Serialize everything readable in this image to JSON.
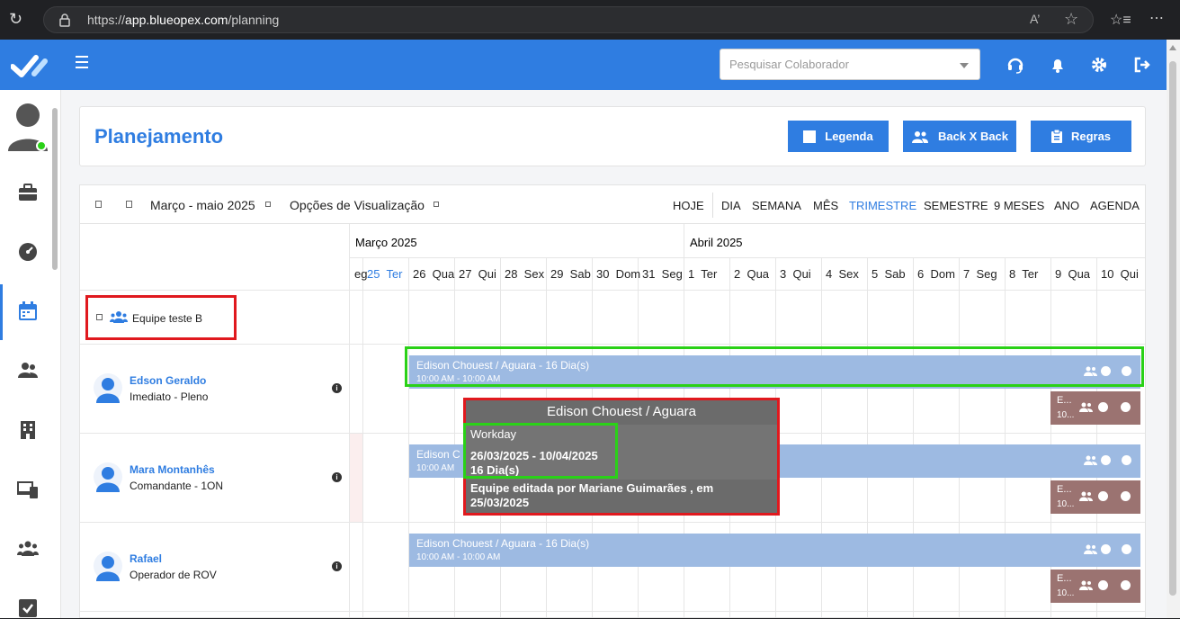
{
  "browser": {
    "url_prefix": "https://",
    "url_host": "app.blueopex.com",
    "url_path": "/planning"
  },
  "header": {
    "search_placeholder": "Pesquisar Colaborador"
  },
  "page": {
    "title": "Planejamento",
    "buttons": {
      "legend": "Legenda",
      "backxback": "Back X Back",
      "rules": "Regras"
    }
  },
  "toolbar": {
    "range": "Março - maio 2025",
    "view_options": "Opções de Visualização",
    "views": [
      "HOJE",
      "DIA",
      "SEMANA",
      "MÊS",
      "TRIMESTRE",
      "SEMESTRE",
      "9 MESES",
      "ANO",
      "AGENDA"
    ],
    "active_view": "TRIMESTRE"
  },
  "calendar": {
    "months": [
      "Março 2025",
      "Abril 2025"
    ],
    "days": [
      "eg",
      "25  Ter",
      "26  Qua",
      "27  Qui",
      "28  Sex",
      "29  Sab",
      "30  Dom",
      "31  Seg",
      "1  Ter",
      "2  Qua",
      "3  Qui",
      "4  Sex",
      "5  Sab",
      "6  Dom",
      "7  Seg",
      "8  Ter",
      "9  Qua",
      "10  Qui"
    ],
    "today_index": 1,
    "team": "Equipe teste B",
    "people": [
      {
        "name": "Edson Geraldo",
        "role": "Imediato - Pleno"
      },
      {
        "name": "Mara Montanhês",
        "role": "Comandante - 1ON"
      },
      {
        "name": "Rafael",
        "role": "Operador de ROV"
      }
    ],
    "event_title": "Edison Chouest / Aguara - 16 Dia(s)",
    "event_title_short": "Edison C",
    "event_time": "10:00 AM - 10:00 AM",
    "event_time_short": "10:00 AM",
    "brown_title": "E...",
    "brown_time": "10..."
  },
  "tooltip": {
    "header": "Edison Chouest / Aguara",
    "type": "Workday",
    "dates": "26/03/2025 - 10/04/2025",
    "days": "16 Dia(s)",
    "note": "Equipe editada por Mariane Guimarães , em 25/03/2025"
  }
}
